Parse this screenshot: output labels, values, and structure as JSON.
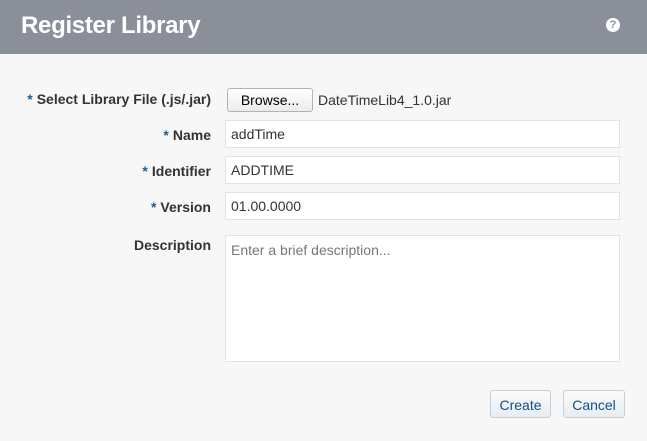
{
  "dialog": {
    "title": "Register Library",
    "help_icon": "?"
  },
  "form": {
    "required_marker": "*",
    "library_file": {
      "label": "Select Library File (.js/.jar)",
      "browse_label": "Browse...",
      "file_name": "DateTimeLib4_1.0.jar"
    },
    "name": {
      "label": "Name",
      "value": "addTime"
    },
    "identifier": {
      "label": "Identifier",
      "value": "ADDTIME"
    },
    "version": {
      "label": "Version",
      "value": "01.00.0000"
    },
    "description": {
      "label": "Description",
      "value": "",
      "placeholder": "Enter a brief description..."
    }
  },
  "buttons": {
    "create_label": "Create",
    "cancel_label": "Cancel"
  }
}
